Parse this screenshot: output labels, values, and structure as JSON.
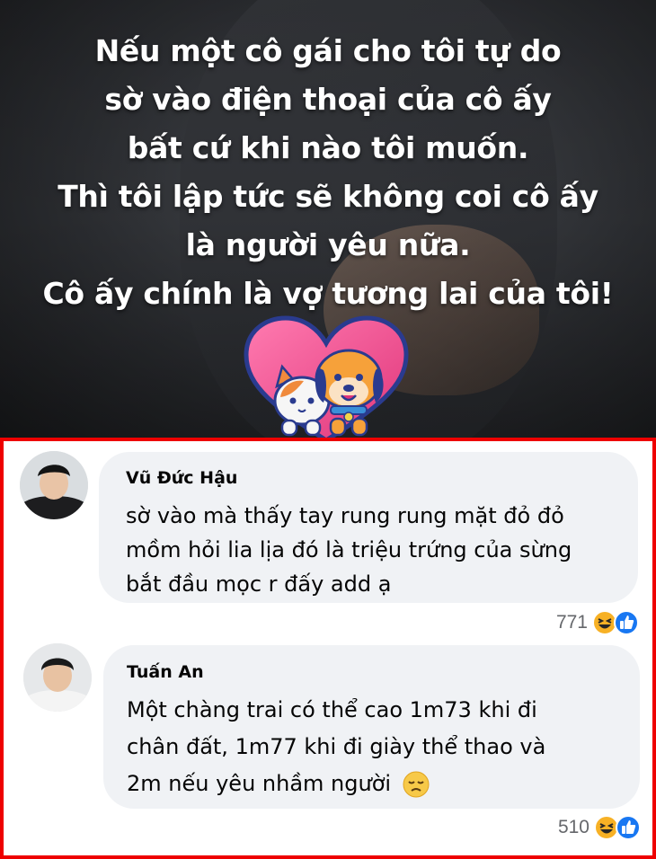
{
  "post": {
    "caption_lines": [
      "Nếu một cô gái cho tôi tự do",
      "sờ vào điện thoại của cô ấy",
      "bất cứ khi nào tôi muốn.",
      "Thì tôi lập tức sẽ không coi cô ấy",
      "là người yêu nữa.",
      "Cô ấy chính là vợ tương lai của tôi!"
    ],
    "logo_icon": "heart-cat-dog-logo"
  },
  "colors": {
    "panel_border": "#ee0000",
    "bubble_bg": "#f0f2f5",
    "like_blue": "#1877f2",
    "haha_yellow": "#f7b125"
  },
  "comments": [
    {
      "author": "Vũ Đức Hậu",
      "text_lines": [
        " sờ vào mà thấy tay rung rung mặt đỏ đỏ",
        "mồm hỏi lia lịa đó là triệu trứng của sừng",
        "bắt đầu mọc r đấy  add ạ"
      ],
      "reaction_count": "771",
      "reaction_icons": [
        "haha-icon",
        "like-icon"
      ]
    },
    {
      "author": "Tuấn An",
      "text_lines": [
        "Một chàng trai có thể cao 1m73 khi đi",
        "chân đất, 1m77 khi đi giày thể thao  và",
        "2m nếu yêu nhầm người"
      ],
      "emoji": "disappointed-face-icon",
      "reaction_count": "510",
      "reaction_icons": [
        "haha-icon",
        "like-icon"
      ]
    }
  ]
}
